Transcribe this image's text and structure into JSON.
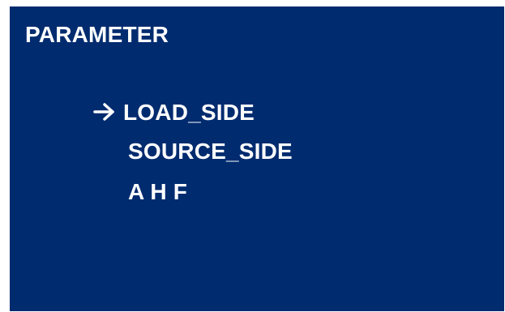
{
  "screen": {
    "title": "PARAMETER",
    "background_color": "#002b6f",
    "text_color": "#ffffff"
  },
  "menu": {
    "items": [
      {
        "label": "LOAD_SIDE",
        "selected": true,
        "icon": "arrow-right-icon"
      },
      {
        "label": "SOURCE_SIDE",
        "selected": false
      },
      {
        "label": "A H F",
        "selected": false
      }
    ]
  }
}
